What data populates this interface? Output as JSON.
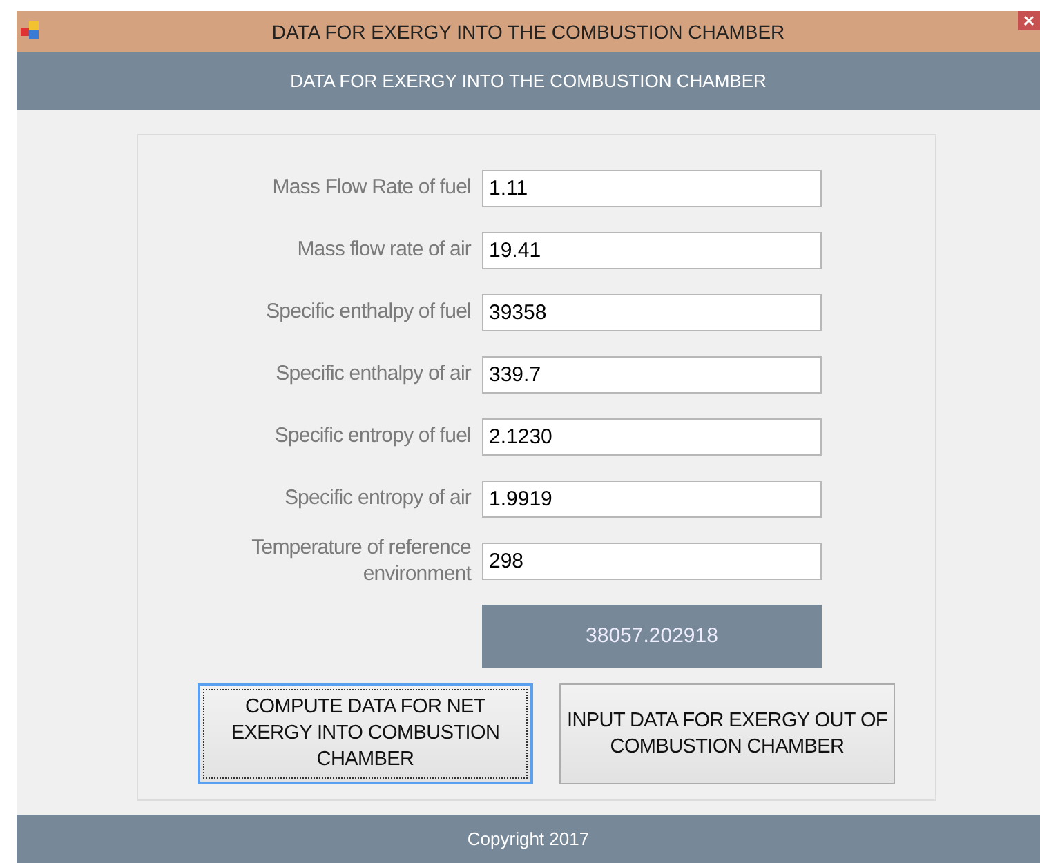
{
  "window": {
    "title": "DATA FOR EXERGY INTO THE COMBUSTION CHAMBER"
  },
  "header": "DATA FOR EXERGY INTO THE COMBUSTION CHAMBER",
  "fields": [
    {
      "label": "Mass Flow Rate of fuel",
      "value": "1.11"
    },
    {
      "label": "Mass flow rate of air",
      "value": "19.41"
    },
    {
      "label": "Specific enthalpy of fuel",
      "value": "39358"
    },
    {
      "label": "Specific enthalpy of air",
      "value": "339.7"
    },
    {
      "label": "Specific entropy of fuel",
      "value": "2.1230"
    },
    {
      "label": "Specific entropy of air",
      "value": "1.9919"
    },
    {
      "label": "Temperature of reference environment",
      "value": "298"
    }
  ],
  "result": "38057.202918",
  "buttons": [
    {
      "label": "COMPUTE DATA FOR NET EXERGY INTO COMBUSTION CHAMBER",
      "selected": true
    },
    {
      "label": "INPUT DATA FOR EXERGY OUT OF COMBUSTION CHAMBER",
      "selected": false
    }
  ],
  "footer": "Copyright 2017"
}
